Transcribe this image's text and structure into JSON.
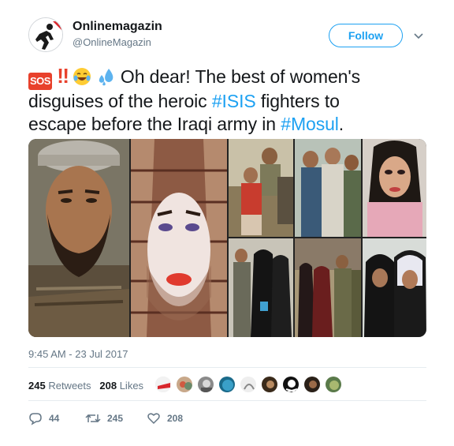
{
  "author": {
    "name": "Onlinemagazin",
    "handle": "@OnlineMagazin",
    "avatar_icon": "running-man-logo-icon"
  },
  "follow_label": "Follow",
  "more_icon": "chevron-down-icon",
  "tweet": {
    "emoji_sos": "SOS",
    "emoji_bang": "‼",
    "line1_text": " Oh dear! The best of women's",
    "line2_pre": "disguises of the heroic ",
    "hashtag_isis": "#ISIS",
    "line2_post": " fighters to",
    "line3_pre": "escape before the Iraqi army in ",
    "hashtag_mosul": "#Mosul",
    "line3_post": "."
  },
  "timestamp": "9:45 AM - 23 Jul 2017",
  "stats": {
    "retweets_count": "245",
    "retweets_label": "Retweets",
    "likes_count": "208",
    "likes_label": "Likes"
  },
  "actions": {
    "reply_count": "44",
    "retweet_count": "245",
    "like_count": "208"
  },
  "colors": {
    "accent": "#1da1f2",
    "text": "#14171a",
    "muted": "#657786",
    "sos_red": "#e8412c"
  }
}
